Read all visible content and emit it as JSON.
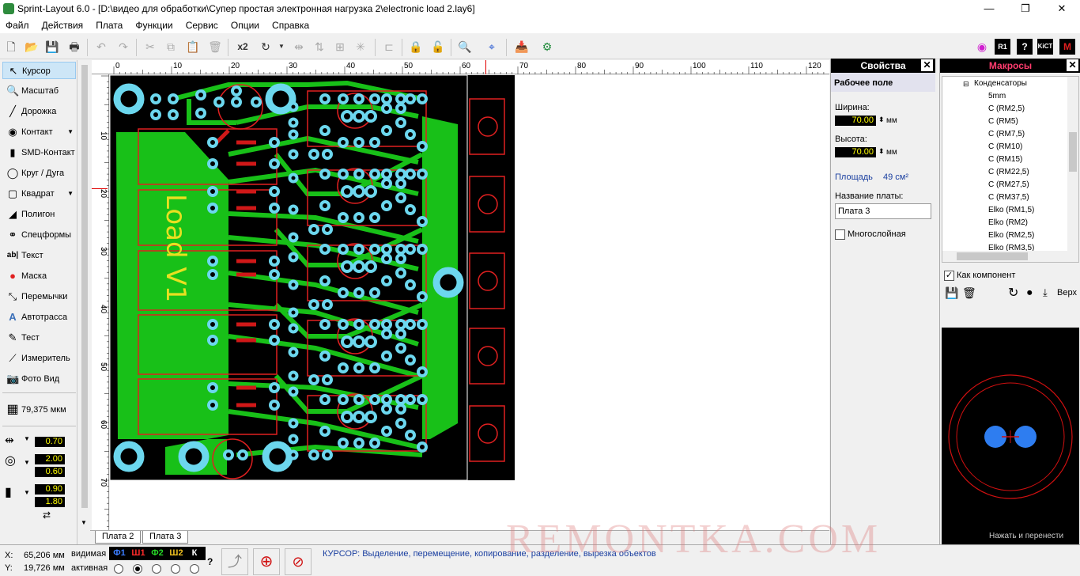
{
  "window": {
    "title": "Sprint-Layout 6.0 - [D:\\видео для обработки\\Супер простая электронная нагрузка 2\\electronic load 2.lay6]",
    "minimize": "—",
    "maximize": "❐",
    "close": "✕"
  },
  "menu": [
    "Файл",
    "Действия",
    "Плата",
    "Функции",
    "Сервис",
    "Опции",
    "Справка"
  ],
  "toolbar": {
    "multiply_label": "x2"
  },
  "tools": [
    {
      "label": "Курсор",
      "icon": "cursor-icon"
    },
    {
      "label": "Масштаб",
      "icon": "zoom-icon"
    },
    {
      "label": "Дорожка",
      "icon": "track-icon"
    },
    {
      "label": "Контакт",
      "icon": "pad-icon"
    },
    {
      "label": "SMD-Контакт",
      "icon": "smd-pad-icon"
    },
    {
      "label": "Круг / Дуга",
      "icon": "circle-icon"
    },
    {
      "label": "Квадрат",
      "icon": "square-icon"
    },
    {
      "label": "Полигон",
      "icon": "polygon-icon"
    },
    {
      "label": "Спецформы",
      "icon": "special-shapes-icon"
    },
    {
      "label": "Текст",
      "icon": "text-icon"
    },
    {
      "label": "Маска",
      "icon": "mask-icon"
    },
    {
      "label": "Перемычки",
      "icon": "jumper-icon"
    },
    {
      "label": "Автотрасса",
      "icon": "autoroute-icon"
    },
    {
      "label": "Тест",
      "icon": "test-icon"
    },
    {
      "label": "Измеритель",
      "icon": "measure-icon"
    },
    {
      "label": "Фото Вид",
      "icon": "photo-view-icon"
    }
  ],
  "grid": {
    "value": "79,375 мкм"
  },
  "dims": {
    "track_width": "0.70",
    "pad_outer": "2.00",
    "pad_inner": "0.60",
    "smd_w": "0.90",
    "smd_h": "1.80"
  },
  "ruler": {
    "unit": "мм",
    "top_ticks": [
      "0",
      "10",
      "20",
      "30",
      "40",
      "50",
      "60",
      "70",
      "80",
      "90",
      "100",
      "110",
      "120"
    ],
    "left_ticks": [
      "10",
      "20",
      "30",
      "40",
      "50",
      "60",
      "70"
    ]
  },
  "tabs": [
    "Плата 2",
    "Плата 3"
  ],
  "pcb": {
    "text": "Load V1"
  },
  "properties": {
    "title": "Свойства",
    "section": "Рабочее поле",
    "width_label": "Ширина:",
    "width_value": "70.00",
    "height_label": "Высота:",
    "height_value": "70.00",
    "unit": "мм",
    "area_label": "Площадь",
    "area_value": "49 см²",
    "name_label": "Название платы:",
    "name_value": "Плата  3",
    "multilayer_label": "Многослойная"
  },
  "macros": {
    "title": "Макросы",
    "folder": "Конденсаторы",
    "items": [
      "5mm",
      "C (RM2,5)",
      "C (RM5)",
      "C (RM7,5)",
      "C (RM10)",
      "C (RM15)",
      "C (RM22,5)",
      "C (RM27,5)",
      "C (RM37,5)",
      "Elko (RM1,5)",
      "Elko (RM2)",
      "Elko (RM2,5)",
      "Elko (RM3,5)"
    ],
    "as_component": "Как компонент",
    "top_label": "Верх",
    "hint": "Нажать и перенести"
  },
  "status": {
    "x_label": "X:",
    "x_value": "65,206 мм",
    "y_label": "Y:",
    "y_value": "19,726 мм",
    "visible_label": "видимая",
    "active_label": "активная",
    "layers": [
      {
        "name": "Ф1",
        "color": "#3b7dff"
      },
      {
        "name": "Ш1",
        "color": "#ff2b2b"
      },
      {
        "name": "Ф2",
        "color": "#27d427"
      },
      {
        "name": "Ш2",
        "color": "#f0c020"
      },
      {
        "name": "К",
        "color": "#ffffff"
      }
    ],
    "help": "?",
    "message": "КУРСОР: Выделение, перемещение, копирование, разделение, вырезка объектов"
  },
  "watermark": "REMONTKA.COM",
  "colors": {
    "copper": "#18c018",
    "pad": "#6cd7ee",
    "silk": "#e02020",
    "board": "#000000"
  }
}
